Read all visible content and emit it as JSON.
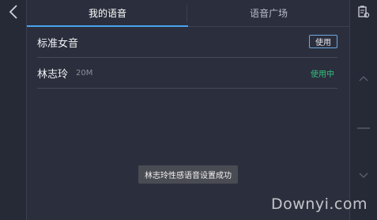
{
  "nav": {
    "back_icon": "chevron-left-icon",
    "action_icon": "clipboard-settings-icon"
  },
  "tabs": [
    {
      "label": "我的语音",
      "active": true
    },
    {
      "label": "语音广场",
      "active": false
    }
  ],
  "voices": [
    {
      "title": "标准女音",
      "size": "",
      "action_label": "使用",
      "status": ""
    },
    {
      "title": "林志玲",
      "size": "20M",
      "action_label": "",
      "status": "使用中"
    }
  ],
  "side_controls": {
    "up_icon": "chevron-up-icon",
    "divider_icon": "dash-icon",
    "down_icon": "chevron-down-icon"
  },
  "toast": {
    "text": "林志玲性感语音设置成功"
  },
  "watermark": {
    "text": "Downyi.com"
  },
  "colors": {
    "background": "#2b2f3d",
    "accent": "#4aa3f0",
    "in_use": "#2ec27e"
  }
}
